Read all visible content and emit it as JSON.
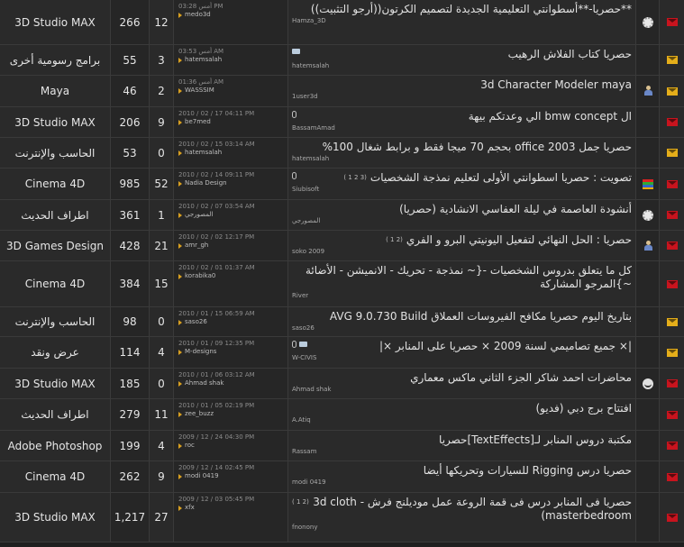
{
  "rows": [
    {
      "title": "**حصريا-**أسطوانتي التعليمية الجديدة لتصميم الكرتون((أرجو التثبيت))",
      "author": "Hamza_3D",
      "last_date": "أمس 03:28 PM",
      "last_user": "medo3d",
      "replies": "12",
      "views": "266",
      "forum": "3D Studio MAX",
      "status": "red",
      "icon": "gear",
      "extras": ""
    },
    {
      "title": "حصريا كتاب الفلاش الرهيب",
      "author": "hatemsalah",
      "last_date": "أمس 03:53 AM",
      "last_user": "hatemsalah",
      "replies": "3",
      "views": "55",
      "forum": "برامج رسومية أخرى",
      "status": "yellow",
      "icon": "",
      "extras": "tag"
    },
    {
      "title": "3d Character Modeler maya",
      "author": "1user3d",
      "last_date": "أمس 01:36 AM",
      "last_user": "WASSSIM",
      "replies": "2",
      "views": "46",
      "forum": "Maya",
      "status": "yellow",
      "icon": "person",
      "extras": ""
    },
    {
      "title": "ال bmw concept الي وعدتكم بيهة",
      "author": "BassamAmad",
      "last_date": "2010 / 02 / 17 04:11 PM",
      "last_user": "be7med",
      "replies": "9",
      "views": "206",
      "forum": "3D Studio MAX",
      "status": "red",
      "icon": "",
      "extras": "clip"
    },
    {
      "title": "حصريا جمل office 2003 بحجم 70 ميجا فقط و برابط شغال 100%",
      "author": "hatemsalah",
      "last_date": "2010 / 02 / 15 03:14 AM",
      "last_user": "hatemsalah",
      "replies": "0",
      "views": "53",
      "forum": "الحاسب والإنترنت",
      "status": "yellow",
      "icon": "",
      "extras": ""
    },
    {
      "title": "تصويت : حصريا اسطوانتي الأولى لتعليم نمذجة الشخصيات",
      "author": "Siubisoft",
      "last_date": "2010 / 02 / 14 09:11 PM",
      "last_user": "Nadia Design",
      "replies": "52",
      "views": "985",
      "forum": "Cinema 4D",
      "status": "red",
      "icon": "poll",
      "extras": "clip",
      "badges": "( 1 2 3)"
    },
    {
      "title": "أنشودة العاصمة في ليلة العفاسي الانشادية (حصريا)",
      "author": "المصورجي",
      "last_date": "2010 / 02 / 07 03:54 AM",
      "last_user": "المصورجي",
      "replies": "1",
      "views": "361",
      "forum": "اطراف الحديث",
      "status": "red",
      "icon": "gear",
      "extras": ""
    },
    {
      "title": "حصريا : الحل النهائي لتفعيل اليونيتي البرو و الفري",
      "author": "soko 2009",
      "last_date": "2010 / 02 / 02 12:17 PM",
      "last_user": "amr_gh",
      "replies": "21",
      "views": "428",
      "forum": "3D Games Design",
      "status": "red",
      "icon": "person",
      "extras": "",
      "badges": "( 1 2)"
    },
    {
      "title": "كل ما يتعلق بدروس الشخصيات -{~ نمذجة - تحريك - الانميشن - الأضائة ~}المرجو المشاركة",
      "author": "River",
      "last_date": "2010 / 02 / 01 01:37 AM",
      "last_user": "korabika0",
      "replies": "15",
      "views": "384",
      "forum": "Cinema 4D",
      "status": "red",
      "icon": "",
      "extras": ""
    },
    {
      "title": "بتاريخ اليوم حصريا مكافح الفيروسات العملاق AVG 9.0.730 Build",
      "author": "saso26",
      "last_date": "2010 / 01 / 15 06:59 AM",
      "last_user": "saso26",
      "replies": "0",
      "views": "98",
      "forum": "الحاسب والإنترنت",
      "status": "yellow",
      "icon": "",
      "extras": ""
    },
    {
      "title": "|× جميع تصاميمي لسنة 2009 × حصريا على المنابر ×|",
      "author": "W-CIVIS",
      "last_date": "2010 / 01 / 09 12:35 PM",
      "last_user": "M-designs",
      "replies": "4",
      "views": "114",
      "forum": "عرض ونقد",
      "status": "yellow",
      "icon": "",
      "extras": "tag-clip"
    },
    {
      "title": "محاضرات احمد شاكر الجزء الثاني ماكس معماري",
      "author": "Ahmad shak",
      "last_date": "2010 / 01 / 06 03:12 AM",
      "last_user": "Ahmad shak",
      "replies": "0",
      "views": "185",
      "forum": "3D Studio MAX",
      "status": "red",
      "icon": "smile",
      "extras": ""
    },
    {
      "title": "افتتاح برج دبي (فديو)",
      "author": "A.Atiq",
      "last_date": "2010 / 01 / 05 02:19 PM",
      "last_user": "zee_buzz",
      "replies": "11",
      "views": "279",
      "forum": "اطراف الحديث",
      "status": "red",
      "icon": "",
      "extras": ""
    },
    {
      "title": "مكتبة دروس المنابر لـ[TextEffects]حصريا",
      "author": "Rassam",
      "last_date": "2009 / 12 / 24 04:30 PM",
      "last_user": "roc",
      "replies": "4",
      "views": "199",
      "forum": "Adobe Photoshop",
      "status": "red",
      "icon": "",
      "extras": ""
    },
    {
      "title": "حصريا درس Rigging للسيارات وتحريكها أيضا",
      "author": "modi 0419",
      "last_date": "2009 / 12 / 14 02:45 PM",
      "last_user": "modi 0419",
      "replies": "9",
      "views": "262",
      "forum": "Cinema 4D",
      "status": "red",
      "icon": "",
      "extras": ""
    },
    {
      "title": "حصريا فى المنابر درس فى قمة الروعة عمل موديلنج فرش - 3d cloth (masterbedroom",
      "author": "fnonony",
      "last_date": "2009 / 12 / 03 05:45 PM",
      "last_user": "xfx",
      "replies": "27",
      "views": "1,217",
      "forum": "3D Studio MAX",
      "status": "red",
      "icon": "",
      "extras": "",
      "badges": "( 1 2)"
    }
  ],
  "colors": {
    "red_envelope": "#c8141e",
    "yellow_envelope": "#e5ae1a"
  }
}
